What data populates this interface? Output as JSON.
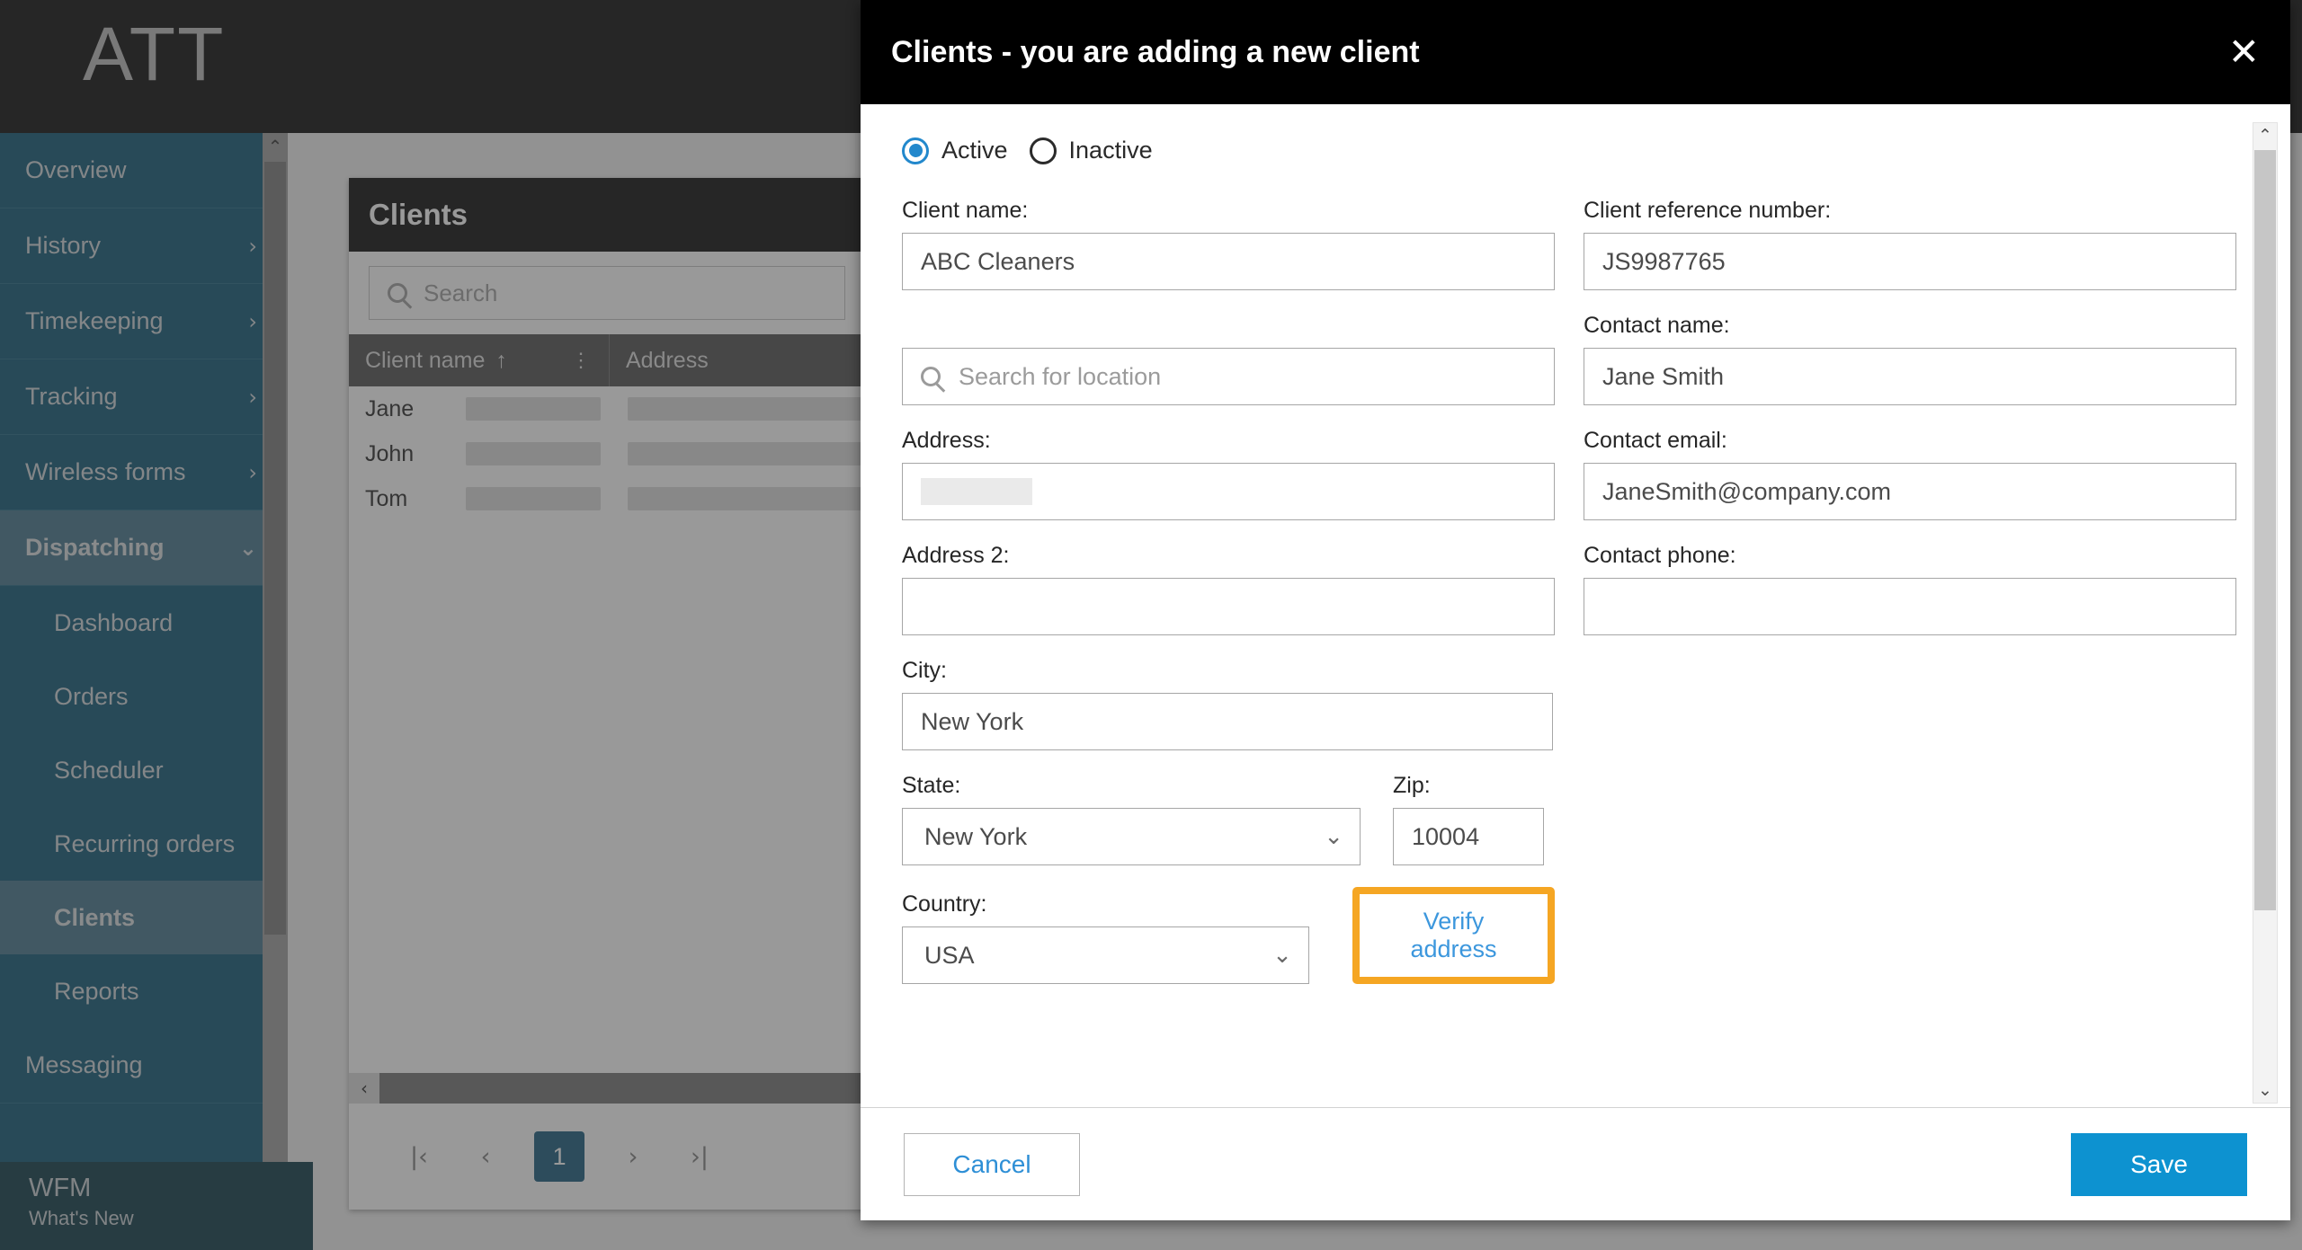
{
  "app": {
    "brand": "ATT",
    "sidebar": {
      "items": [
        {
          "label": "Overview",
          "chevron": "",
          "level": "top",
          "state": "normal"
        },
        {
          "label": "History",
          "chevron": "›",
          "level": "top",
          "state": "normal"
        },
        {
          "label": "Timekeeping",
          "chevron": "›",
          "level": "top",
          "state": "normal"
        },
        {
          "label": "Tracking",
          "chevron": "›",
          "level": "top",
          "state": "normal"
        },
        {
          "label": "Wireless forms",
          "chevron": "›",
          "level": "top",
          "state": "normal"
        },
        {
          "label": "Dispatching",
          "chevron": "⌄",
          "level": "top",
          "state": "expanded"
        },
        {
          "label": "Dashboard",
          "chevron": "",
          "level": "sub",
          "state": "normal"
        },
        {
          "label": "Orders",
          "chevron": "",
          "level": "sub",
          "state": "normal"
        },
        {
          "label": "Scheduler",
          "chevron": "",
          "level": "sub",
          "state": "normal"
        },
        {
          "label": "Recurring orders",
          "chevron": "",
          "level": "sub",
          "state": "normal"
        },
        {
          "label": "Clients",
          "chevron": "",
          "level": "sub",
          "state": "selected"
        },
        {
          "label": "Reports",
          "chevron": "",
          "level": "sub",
          "state": "normal"
        },
        {
          "label": "Messaging",
          "chevron": "",
          "level": "top",
          "state": "normal"
        }
      ],
      "scroll_up_icon": "⌃",
      "scroll_down_icon": "⌄"
    },
    "footer": {
      "title": "WFM",
      "subtitle": "What's New"
    },
    "clients_panel": {
      "title": "Clients",
      "search_placeholder": "Search",
      "search_icon": "search-icon",
      "columns": [
        {
          "label": "Client name",
          "sort": "↑",
          "kebab": "⋮"
        },
        {
          "label": "Address",
          "sort": "",
          "kebab": "⋮"
        }
      ],
      "rows": [
        {
          "client_name": "Jane"
        },
        {
          "client_name": "John"
        },
        {
          "client_name": "Tom"
        }
      ],
      "hscroll_left_icon": "‹",
      "pagination": {
        "first": "|‹",
        "prev": "‹",
        "current": "1",
        "next": "›",
        "last": "›|"
      }
    }
  },
  "modal": {
    "title": "Clients - you are adding a new client",
    "close_icon": "✕",
    "status": {
      "active_label": "Active",
      "inactive_label": "Inactive",
      "selected": "Active"
    },
    "fields": {
      "client_name": {
        "label": "Client name:",
        "value": "ABC Cleaners"
      },
      "client_reference_number": {
        "label": "Client reference number:",
        "value": "JS9987765"
      },
      "location_search": {
        "label": "",
        "placeholder": "Search for location",
        "value": ""
      },
      "contact_name": {
        "label": "Contact name:",
        "value": "Jane Smith"
      },
      "address": {
        "label": "Address:",
        "value": ""
      },
      "contact_email": {
        "label": "Contact email:",
        "value": "JaneSmith@company.com"
      },
      "address2": {
        "label": "Address 2:",
        "value": ""
      },
      "contact_phone": {
        "label": "Contact phone:",
        "value": ""
      },
      "city": {
        "label": "City:",
        "value": "New York"
      },
      "state": {
        "label": "State:",
        "value": "New York",
        "caret": "⌄"
      },
      "zip": {
        "label": "Zip:",
        "value": "10004"
      },
      "country": {
        "label": "Country:",
        "value": "USA",
        "caret": "⌄"
      }
    },
    "verify_address_label": "Verify address",
    "cancel_label": "Cancel",
    "save_label": "Save",
    "scroll_up_icon": "⌃",
    "scroll_down_icon": "⌄"
  },
  "colors": {
    "sidebar_base": "#05506f",
    "sidebar_active": "#3d7087",
    "accent_blue": "#0d92d0",
    "link_blue": "#2e8fd6",
    "focus_orange": "#f5a623",
    "header_black": "#000000",
    "page_blue": "#105679"
  }
}
